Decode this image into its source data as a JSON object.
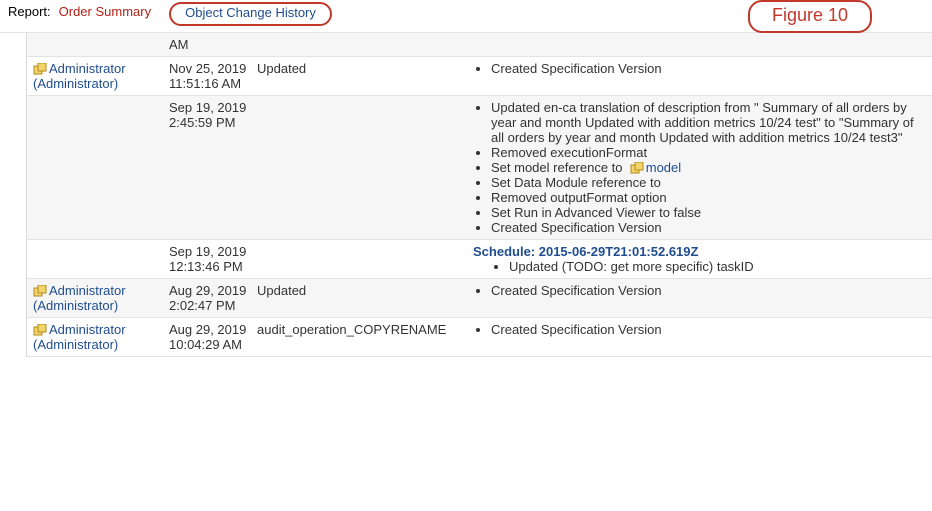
{
  "topbar": {
    "report_label": "Report:",
    "report_name": "Order Summary",
    "active_tab": "Object Change History",
    "figure_label": "Figure 10"
  },
  "user": {
    "display": "Administrator",
    "role": "(Administrator)"
  },
  "model_link_text": "model",
  "rows": [
    {
      "show_user": false,
      "date": "AM",
      "operation": "",
      "details": {
        "type": "none"
      }
    },
    {
      "show_user": true,
      "date": "Nov 25, 2019 11:51:16 AM",
      "operation": "Updated",
      "details": {
        "type": "bullets",
        "items": [
          "Created Specification Version"
        ]
      }
    },
    {
      "show_user": false,
      "date": "Sep 19, 2019 2:45:59 PM",
      "operation": "",
      "details": {
        "type": "bullets",
        "items": [
          " Updated en-ca translation of description from \" Summary of all orders by year and month Updated with addition metrics 10/24 test\" to \"Summary of all orders by year and month Updated with addition metrics 10/24 test3\"",
          "Removed executionFormat",
          "__model__",
          "Set Data Module reference to",
          "Removed outputFormat option",
          "Set Run in Advanced Viewer to false",
          "Created Specification Version"
        ]
      }
    },
    {
      "show_user": false,
      "date": "Sep 19, 2019 12:13:46 PM",
      "operation": "",
      "details": {
        "type": "schedule",
        "label": "Schedule: 2015-06-29T21:01:52.619Z",
        "items": [
          "Updated (TODO: get more specific) taskID"
        ]
      }
    },
    {
      "show_user": true,
      "date": "Aug 29, 2019 2:02:47 PM",
      "operation": "Updated",
      "details": {
        "type": "bullets",
        "items": [
          "Created Specification Version"
        ]
      }
    },
    {
      "show_user": true,
      "date": "Aug 29, 2019 10:04:29 AM",
      "operation": "audit_operation_COPYRENAME",
      "details": {
        "type": "bullets",
        "items": [
          "Created Specification Version"
        ]
      }
    }
  ]
}
